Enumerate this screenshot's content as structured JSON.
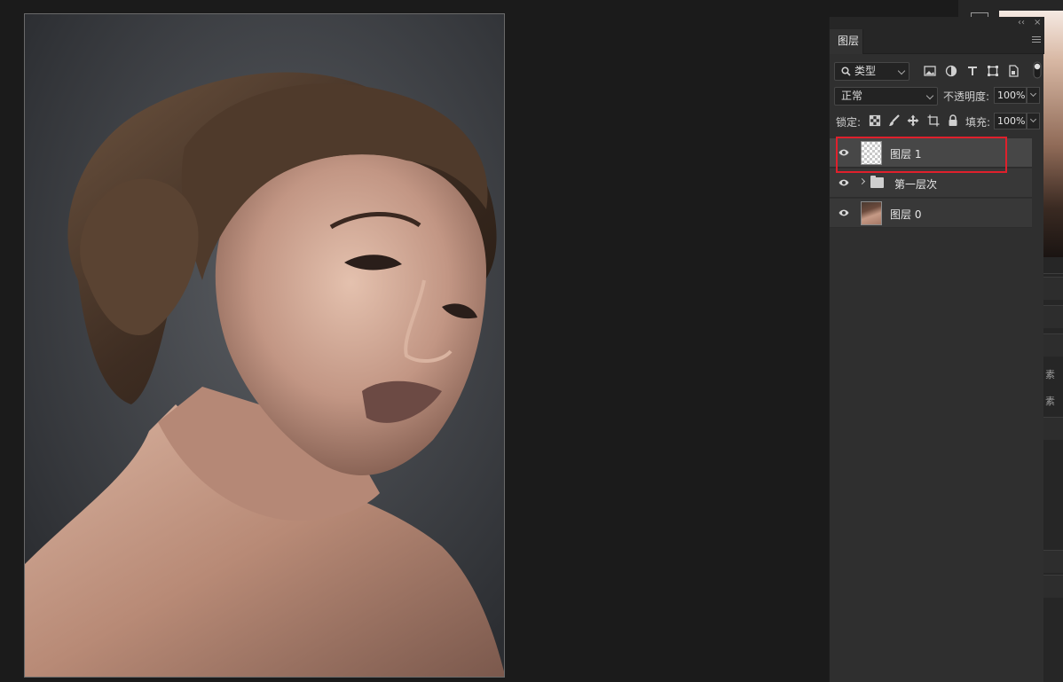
{
  "panel": {
    "tab_label": "图层",
    "collapse_glyph": "‹‹",
    "close_glyph": "×"
  },
  "filter": {
    "kind_label": "类型",
    "icons": [
      "image-filter-icon",
      "adjustment-filter-icon",
      "type-filter-icon",
      "shape-filter-icon",
      "smart-object-filter-icon",
      "filter-toggle-icon"
    ]
  },
  "blend": {
    "mode": "正常",
    "opacity_label": "不透明度:",
    "opacity_value": "100%"
  },
  "lock": {
    "label": "锁定:",
    "icons": [
      "lock-transparent-icon",
      "lock-image-icon",
      "lock-position-icon",
      "lock-artboard-icon",
      "lock-all-icon"
    ],
    "fill_label": "填充:",
    "fill_value": "100%"
  },
  "layers": [
    {
      "name": "图层 1",
      "type": "pixel",
      "visible": true,
      "selected": true,
      "thumbnail": "transparent"
    },
    {
      "name": "第一层次",
      "type": "group",
      "visible": true,
      "selected": false,
      "collapsed": true
    },
    {
      "name": "图层 0",
      "type": "pixel",
      "visible": true,
      "selected": false,
      "thumbnail": "portrait"
    }
  ],
  "side_strip": {
    "text_1": "素",
    "text_2": "素"
  },
  "colors": {
    "highlight": "#e0202c",
    "panel_bg": "#2f2f2f",
    "selected_row": "#474747",
    "app_bg": "#1b1b1b"
  }
}
